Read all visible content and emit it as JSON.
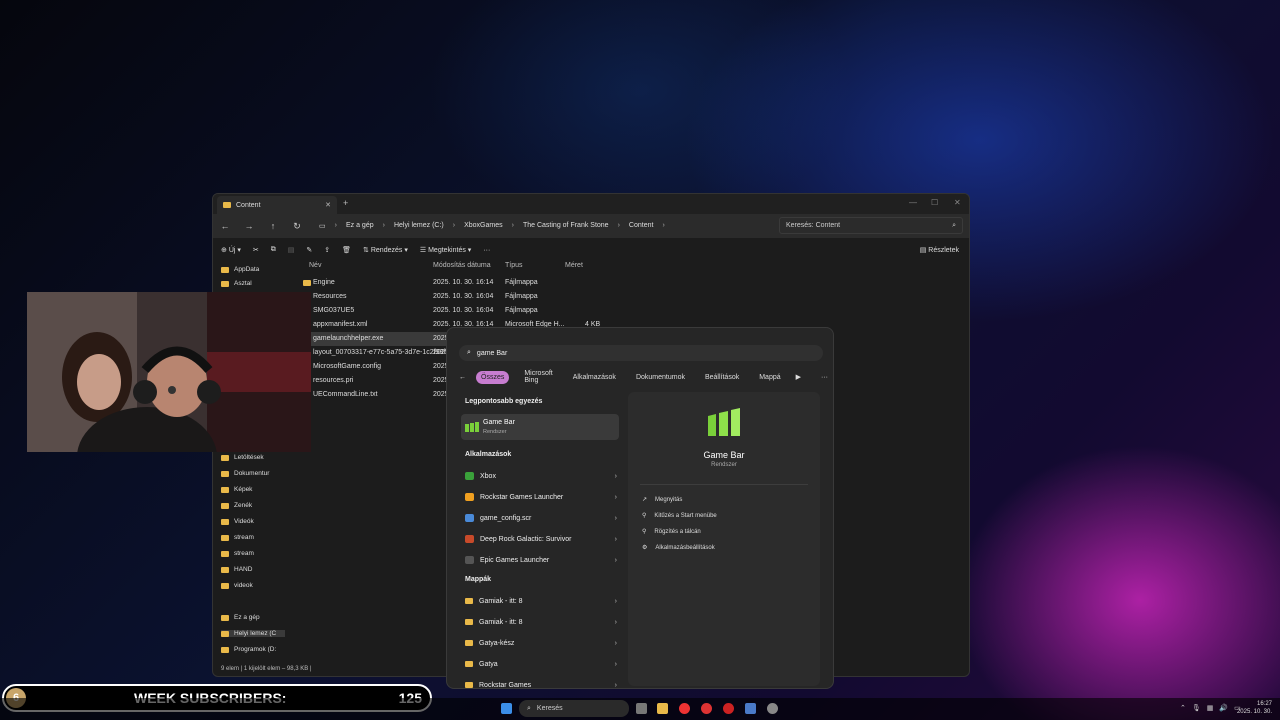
{
  "explorer": {
    "tab_title": "Content",
    "breadcrumb": [
      "Ez a gép",
      "Helyi lemez (C:)",
      "XboxGames",
      "The Casting of Frank Stone",
      "Content"
    ],
    "search_placeholder": "Keresés: Content",
    "toolbar": {
      "new": "Új",
      "sort": "Rendezés",
      "view": "Megtekintés",
      "details": "Részletek"
    },
    "columns": {
      "name": "Név",
      "date": "Módosítás dátuma",
      "type": "Típus",
      "size": "Méret"
    },
    "files": [
      {
        "name": "Engine",
        "date": "2025. 10. 30. 16:14",
        "type": "Fájlmappa",
        "size": ""
      },
      {
        "name": "Resources",
        "date": "2025. 10. 30. 16:04",
        "type": "Fájlmappa",
        "size": ""
      },
      {
        "name": "SMG037UE5",
        "date": "2025. 10. 30. 16:04",
        "type": "Fájlmappa",
        "size": ""
      },
      {
        "name": "appxmanifest.xml",
        "date": "2025. 10. 30. 16:14",
        "type": "Microsoft Edge H...",
        "size": "4 KB"
      },
      {
        "name": "gamelaunchhelper.exe",
        "date": "2025.",
        "type": "",
        "size": ""
      },
      {
        "name": "layout_00703317-e77c-5a75-3d7e-1c2f98f...",
        "date": "2025.",
        "type": "",
        "size": ""
      },
      {
        "name": "MicrosoftGame.config",
        "date": "2025.",
        "type": "",
        "size": ""
      },
      {
        "name": "resources.pri",
        "date": "2025.",
        "type": "",
        "size": ""
      },
      {
        "name": "UECommandLine.txt",
        "date": "2025.",
        "type": "",
        "size": ""
      }
    ],
    "sidebar": [
      {
        "label": "AppData"
      },
      {
        "label": "Asztal"
      },
      {
        "label": "Letöltések"
      },
      {
        "label": "Dokumentur"
      },
      {
        "label": "Képek"
      },
      {
        "label": "Zenék"
      },
      {
        "label": "Videók"
      },
      {
        "label": "stream"
      },
      {
        "label": "stream"
      },
      {
        "label": "HAND"
      },
      {
        "label": "videok"
      },
      {
        "label": "Ez a gép"
      },
      {
        "label": "Helyi lemez (C"
      },
      {
        "label": "Programok (D:"
      }
    ],
    "status": "9 elem  |  1 kijelölt elem – 98,3 KB  |"
  },
  "start": {
    "query": "game Bar",
    "filters": [
      "Összes",
      "Microsoft Bing",
      "Alkalmazások",
      "Dokumentumok",
      "Beállítások",
      "Mappá"
    ],
    "best_match_heading": "Legpontosabb egyezés",
    "best_match": {
      "title": "Game Bar",
      "subtitle": "Rendszer"
    },
    "apps_heading": "Alkalmazások",
    "apps": [
      "Xbox",
      "Rockstar Games Launcher",
      "game_config.scr",
      "Deep Rock Galactic: Survivor",
      "Epic Games Launcher"
    ],
    "folders_heading": "Mappák",
    "folders": [
      "Gamiak - itt: 8",
      "Gamiak - itt: 8",
      "Gatya-kész",
      "Gatya",
      "Rockstar Games"
    ],
    "detail": {
      "title": "Game Bar",
      "subtitle": "Rendszer",
      "actions": [
        "Megnyitás",
        "Kitűzés a Start menübe",
        "Rögzítés a tálcán",
        "Alkalmazásbeállítások"
      ]
    }
  },
  "overlay": {
    "sub_number": "6",
    "label": "WEEK SUBSCRIBERS:",
    "count": "125"
  },
  "taskbar": {
    "search": "Keresés",
    "time": "16:27",
    "date": "2025. 10. 30."
  }
}
